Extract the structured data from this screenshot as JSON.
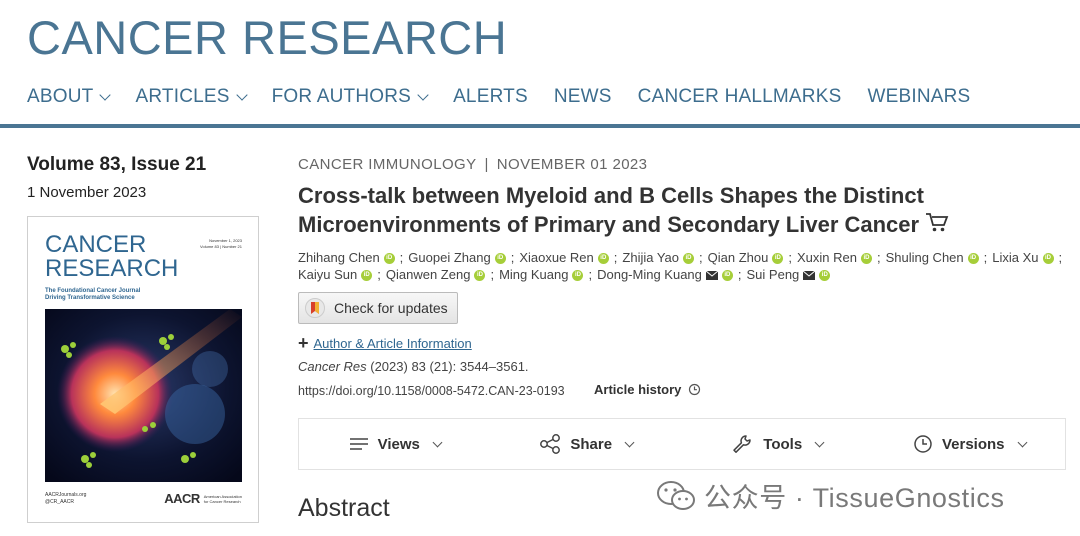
{
  "brand": {
    "title": "CANCER RESEARCH"
  },
  "nav": {
    "items": [
      {
        "label": "ABOUT",
        "dropdown": true
      },
      {
        "label": "ARTICLES",
        "dropdown": true
      },
      {
        "label": "FOR AUTHORS",
        "dropdown": true
      },
      {
        "label": "ALERTS",
        "dropdown": false
      },
      {
        "label": "NEWS",
        "dropdown": false
      },
      {
        "label": "CANCER HALLMARKS",
        "dropdown": false
      },
      {
        "label": "WEBINARS",
        "dropdown": false
      }
    ]
  },
  "issue": {
    "volume": "Volume 83, Issue 21",
    "date": "1 November 2023",
    "cover": {
      "title_line1": "CANCER",
      "title_line2": "RESEARCH",
      "meta_line1": "November 1, 2023",
      "meta_line2": "Volume 83 | Number 21",
      "subtitle_line1": "The Foundational Cancer Journal",
      "subtitle_line2": "Driving Transformative Science",
      "footer_line1": "AACRJournals.org",
      "footer_line2": "@CR_AACR",
      "publisher_logo": "AACR",
      "publisher_line1": "American Association",
      "publisher_line2": "for Cancer Research"
    }
  },
  "article": {
    "section": "CANCER IMMUNOLOGY",
    "separator": "|",
    "date": "NOVEMBER 01 2023",
    "title_line1": "Cross-talk between Myeloid and B Cells Shapes the Distinct",
    "title_line2": "Microenvironments of Primary and Secondary Liver Cancer",
    "authors_line1": [
      {
        "name": "Zhihang Chen",
        "orcid": true,
        "mail": false
      },
      {
        "name": "Guopei Zhang",
        "orcid": true,
        "mail": false
      },
      {
        "name": "Xiaoxue Ren",
        "orcid": true,
        "mail": false
      },
      {
        "name": "Zhijia Yao",
        "orcid": true,
        "mail": false
      },
      {
        "name": "Qian Zhou",
        "orcid": true,
        "mail": false
      },
      {
        "name": "Xuxin Ren",
        "orcid": true,
        "mail": false
      },
      {
        "name": "Shuling Chen",
        "orcid": true,
        "mail": false
      },
      {
        "name": "Lixia Xu",
        "orcid": true,
        "mail": false
      }
    ],
    "authors_line2": [
      {
        "name": "Kaiyu Sun",
        "orcid": true,
        "mail": false
      },
      {
        "name": "Qianwen Zeng",
        "orcid": true,
        "mail": false
      },
      {
        "name": "Ming Kuang",
        "orcid": true,
        "mail": false
      },
      {
        "name": "Dong-Ming Kuang",
        "orcid": true,
        "mail": true
      },
      {
        "name": "Sui Peng",
        "orcid": true,
        "mail": true
      }
    ],
    "check_updates": "Check for updates",
    "author_info": "Author & Article Information",
    "citation_journal": "Cancer Res",
    "citation_rest": " (2023) 83 (21): 3544–3561.",
    "doi": "https://doi.org/10.1158/0008-5472.CAN-23-0193",
    "history": "Article history"
  },
  "toolbar": {
    "views": "Views",
    "share": "Share",
    "tools": "Tools",
    "versions": "Versions"
  },
  "abstract_heading": "Abstract",
  "watermark": "公众号 · TissueGnostics",
  "colors": {
    "brand": "#4a7593",
    "link": "#2f6690",
    "orcid": "#a6ce39"
  }
}
